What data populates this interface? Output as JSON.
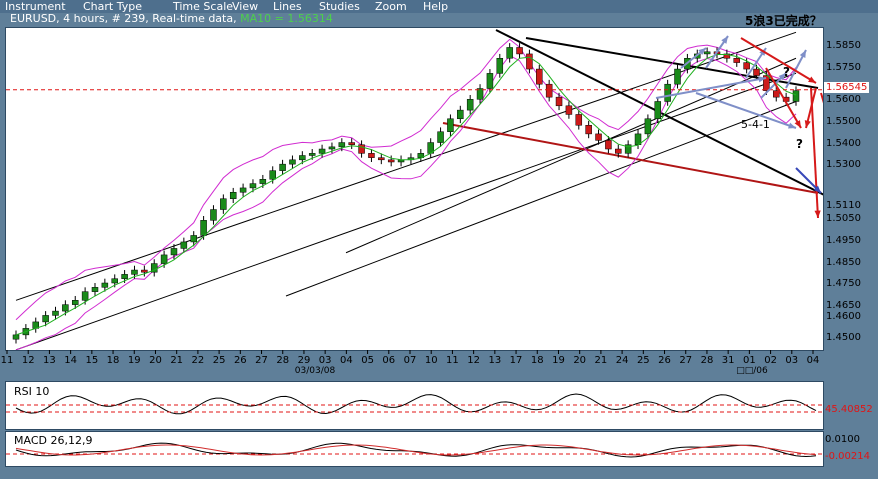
{
  "menu": [
    "Instrument",
    "Chart Type",
    "Time Scale",
    "View",
    "Lines",
    "Studies",
    "Zoom",
    "Help"
  ],
  "annotation_title": "5浪3已完成？",
  "header": {
    "symbol": "EURUSD",
    "timeframe": "4 hours",
    "count": "# 239",
    "feed": "Real-time data",
    "ma_label": "MA10 = 1.56314"
  },
  "colors": {
    "background": "#5f7f99",
    "up_candle": "#1a8a1a",
    "down_candle": "#cc1a1a",
    "ma": "#1fb01f",
    "bollinger": "#d12cd1",
    "trend_black": "#000000",
    "projection_red": "#d61a1a",
    "projection_blue": "#7f8fc8",
    "current_price": "#e01515"
  },
  "chart_data": [
    {
      "type": "candlestick",
      "y_axis_ticks": [
        "1.5850",
        "1.5750",
        "1.5600",
        "1.5500",
        "1.5400",
        "1.5300",
        "1.5110",
        "1.5050",
        "1.4950",
        "1.4850",
        "1.4750",
        "1.4650",
        "1.4600",
        "1.4500"
      ],
      "current_price_label": "1.56545",
      "current_price": 1.56545,
      "x_axis_ticks": [
        "11",
        "12",
        "13",
        "14",
        "15",
        "18",
        "19",
        "20",
        "21",
        "22",
        "25",
        "26",
        "27",
        "28",
        "29",
        "03",
        "04",
        "05",
        "06",
        "07",
        "10",
        "11",
        "12",
        "13",
        "17",
        "18",
        "19",
        "20",
        "21",
        "24",
        "25",
        "26",
        "27",
        "28",
        "31",
        "01",
        "02",
        "03",
        "04"
      ],
      "date_labels": [
        "03/03/08",
        "□□/06"
      ],
      "ylim": [
        1.445,
        1.594
      ],
      "indicators": [
        "MA10",
        "Bollinger Bands"
      ],
      "annotations": [
        "5-4-1",
        "?",
        "?"
      ],
      "close_series": [
        1.452,
        1.455,
        1.458,
        1.461,
        1.463,
        1.466,
        1.468,
        1.472,
        1.474,
        1.476,
        1.478,
        1.48,
        1.482,
        1.481,
        1.485,
        1.489,
        1.492,
        1.495,
        1.498,
        1.505,
        1.51,
        1.515,
        1.518,
        1.52,
        1.522,
        1.524,
        1.528,
        1.531,
        1.533,
        1.535,
        1.536,
        1.538,
        1.539,
        1.541,
        1.54,
        1.536,
        1.534,
        1.533,
        1.532,
        1.533,
        1.534,
        1.536,
        1.541,
        1.546,
        1.552,
        1.556,
        1.561,
        1.566,
        1.573,
        1.58,
        1.585,
        1.582,
        1.575,
        1.568,
        1.562,
        1.558,
        1.554,
        1.549,
        1.545,
        1.542,
        1.538,
        1.536,
        1.54,
        1.545,
        1.552,
        1.56,
        1.568,
        1.575,
        1.58,
        1.582,
        1.583,
        1.582,
        1.58,
        1.578,
        1.575,
        1.572,
        1.565,
        1.562,
        1.56,
        1.565
      ]
    },
    {
      "type": "line",
      "title": "RSI 10",
      "level_label": "45.40852",
      "level": 45.40852
    },
    {
      "type": "line",
      "title": "MACD 26,12,9",
      "y_axis_ticks": [
        "0.0100"
      ],
      "level_label": "-0.00214",
      "level": -0.00214
    }
  ]
}
